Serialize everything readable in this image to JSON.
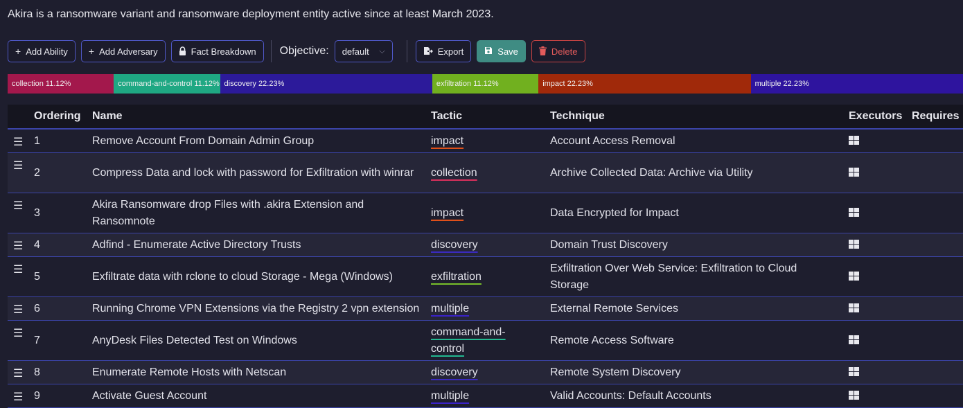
{
  "description": "Akira is a ransomware variant and ransomware deployment entity active since at least March 2023.",
  "toolbar": {
    "add_ability": "Add Ability",
    "add_adversary": "Add Adversary",
    "fact_breakdown": "Fact Breakdown",
    "objective_label": "Objective:",
    "objective_value": "default",
    "export": "Export",
    "save": "Save",
    "delete": "Delete"
  },
  "tactic_bar": [
    {
      "label": "collection 11.12%",
      "percent": 11.12,
      "color": "#a3184c"
    },
    {
      "label": "command-and-control 11.12%",
      "percent": 11.12,
      "color": "#1fa883"
    },
    {
      "label": "discovery 22.23%",
      "percent": 22.23,
      "color": "#2c1a9a"
    },
    {
      "label": "exfiltration 11.12%",
      "percent": 11.12,
      "color": "#71b01f"
    },
    {
      "label": "impact 22.23%",
      "percent": 22.23,
      "color": "#a0290a"
    },
    {
      "label": "multiple 22.23%",
      "percent": 22.23,
      "color": "#2e149e"
    }
  ],
  "table": {
    "headers": {
      "ordering": "Ordering",
      "name": "Name",
      "tactic": "Tactic",
      "technique": "Technique",
      "executors": "Executors",
      "requires": "Requires"
    },
    "tactic_colors": {
      "impact": "#e0501a",
      "collection": "#d8305c",
      "discovery": "#3a2ac0",
      "exfiltration": "#78c02a",
      "multiple": "#3a22c8",
      "command-and-control": "#22b890"
    },
    "rows": [
      {
        "order": "1",
        "name": "Remove Account From Domain Admin Group",
        "tactic": "impact",
        "technique": "Account Access Removal",
        "executor": "windows-icon"
      },
      {
        "order": "2",
        "name": "Compress Data and lock with password for Exfiltration with winrar",
        "tactic": "collection",
        "technique": "Archive Collected Data: Archive via Utility",
        "executor": "windows-icon"
      },
      {
        "order": "3",
        "name": "Akira Ransomware drop Files with .akira Extension and Ransomnote",
        "tactic": "impact",
        "technique": "Data Encrypted for Impact",
        "executor": "windows-icon"
      },
      {
        "order": "4",
        "name": "Adfind - Enumerate Active Directory Trusts",
        "tactic": "discovery",
        "technique": "Domain Trust Discovery",
        "executor": "windows-icon"
      },
      {
        "order": "5",
        "name": "Exfiltrate data with rclone to cloud Storage - Mega (Windows)",
        "tactic": "exfiltration",
        "technique": "Exfiltration Over Web Service: Exfiltration to Cloud Storage",
        "executor": "windows-icon"
      },
      {
        "order": "6",
        "name": "Running Chrome VPN Extensions via the Registry 2 vpn extension",
        "tactic": "multiple",
        "technique": "External Remote Services",
        "executor": "windows-icon"
      },
      {
        "order": "7",
        "name": "AnyDesk Files Detected Test on Windows",
        "tactic": "command-and-control",
        "technique": "Remote Access Software",
        "executor": "windows-icon"
      },
      {
        "order": "8",
        "name": "Enumerate Remote Hosts with Netscan",
        "tactic": "discovery",
        "technique": "Remote System Discovery",
        "executor": "windows-icon"
      },
      {
        "order": "9",
        "name": "Activate Guest Account",
        "tactic": "multiple",
        "technique": "Valid Accounts: Default Accounts",
        "executor": "windows-icon"
      }
    ]
  }
}
